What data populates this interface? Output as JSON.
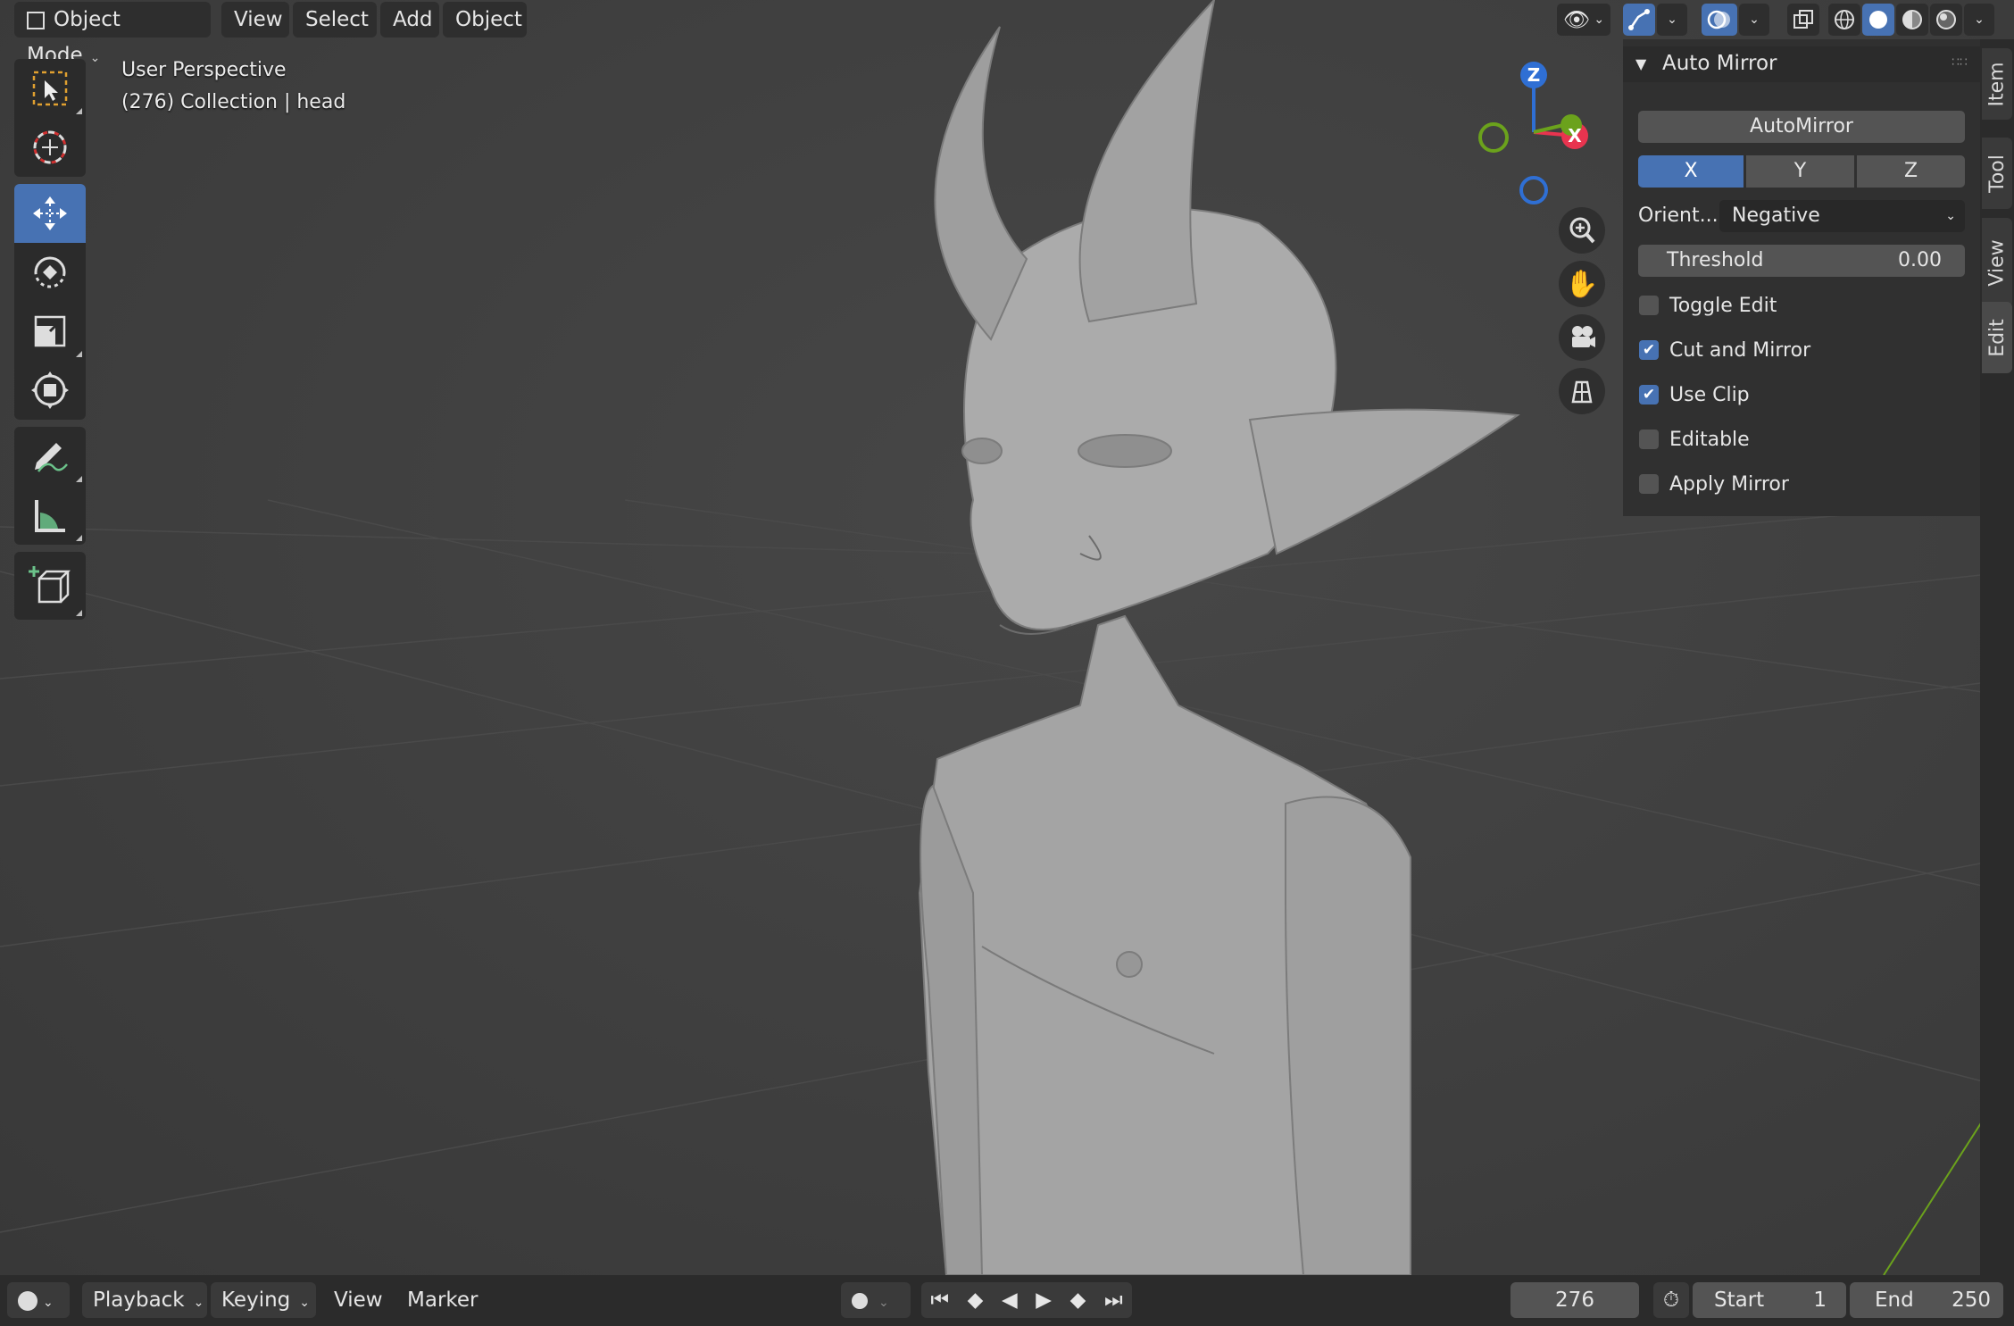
{
  "header": {
    "mode": "Object Mode",
    "menus": [
      "View",
      "Select",
      "Add",
      "Object"
    ]
  },
  "viewport": {
    "perspective": "User Perspective",
    "collection": "(276) Collection | head"
  },
  "gizmo": {
    "x": "X",
    "y": "",
    "z": "Z"
  },
  "panel": {
    "title": "Auto Mirror",
    "automirror_button": "AutoMirror",
    "axes": [
      "X",
      "Y",
      "Z"
    ],
    "active_axis": "X",
    "orient_label": "Orient...",
    "orient_value": "Negative",
    "threshold_label": "Threshold",
    "threshold_value": "0.00",
    "checks": [
      {
        "label": "Toggle Edit",
        "checked": false
      },
      {
        "label": "Cut and Mirror",
        "checked": true
      },
      {
        "label": "Use Clip",
        "checked": true
      },
      {
        "label": "Editable",
        "checked": false
      },
      {
        "label": "Apply Mirror",
        "checked": false
      }
    ]
  },
  "side_tabs": [
    "Item",
    "Tool",
    "View",
    "Edit"
  ],
  "timeline": {
    "menus": [
      "Playback",
      "Keying",
      "View",
      "Marker"
    ],
    "current_frame": "276",
    "start_label": "Start",
    "start_value": "1",
    "end_label": "End",
    "end_value": "250"
  },
  "colors": {
    "accent": "#4772b3",
    "axis_x": "#e8344f",
    "axis_y": "#6ba21c",
    "axis_z": "#2f6fd4"
  }
}
